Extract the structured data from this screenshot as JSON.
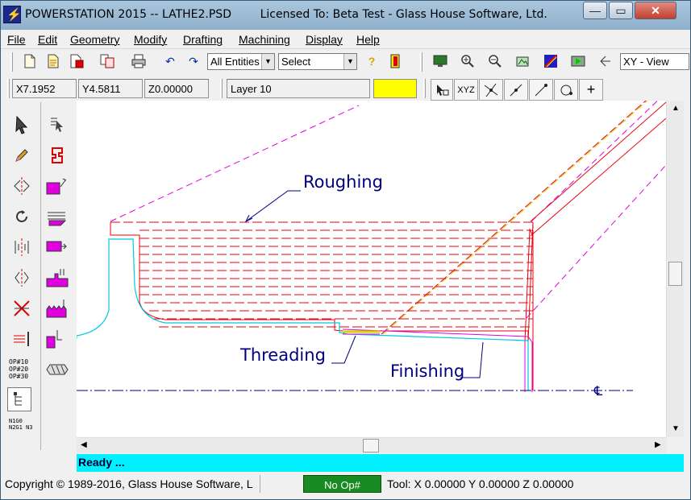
{
  "window": {
    "title": "POWERSTATION 2015 -- LATHE2.PSD",
    "license": "Licensed To: Beta Test - Glass House Software, Ltd.",
    "controls": {
      "minimize": "—",
      "maximize": "▭",
      "close": "✕"
    }
  },
  "menu": [
    "File",
    "Edit",
    "Geometry",
    "Modify",
    "Drafting",
    "Machining",
    "Display",
    "Help"
  ],
  "toolbar": {
    "entities_combo": "All Entities",
    "select_combo": "Select",
    "view_combo": "XY - View",
    "icons": [
      "new-file-icon",
      "open-file-icon",
      "save-file-icon",
      "copy-icon",
      "print-icon",
      "undo-icon",
      "redo-icon",
      "help-icon",
      "exit-icon",
      "monitor-icon",
      "zoom-in-icon",
      "zoom-out-icon",
      "pan-icon",
      "render-icon",
      "simulate-icon",
      "rotate-icon"
    ]
  },
  "coords": {
    "x": "X7.1952",
    "y": "Y4.5811",
    "z": "Z0.00000",
    "layer": "Layer 10",
    "layer_color": "#ffff00"
  },
  "snap_tools": {
    "xyz_label": "XYZ",
    "plus_label": "+"
  },
  "left_tools": {
    "op_labels": [
      "OP#10",
      "OP#20",
      "OP#30"
    ],
    "nc_label": "N1G0 N2G1 N3"
  },
  "drawing": {
    "labels": {
      "roughing": "Roughing",
      "threading": "Threading",
      "finishing": "Finishing",
      "centerline": "℄"
    },
    "colors": {
      "roughing": "#e8000b",
      "finishing": "#00c8e0",
      "magenta": "#e000e0",
      "thread": "#d4d400",
      "annotation": "#00007f"
    }
  },
  "status": {
    "ready": "Ready ...",
    "copyright": "Copyright © 1989-2016, Glass House Software, L",
    "op": "No Op#",
    "tool": "Tool: X 0.00000 Y 0.00000 Z 0.00000"
  }
}
